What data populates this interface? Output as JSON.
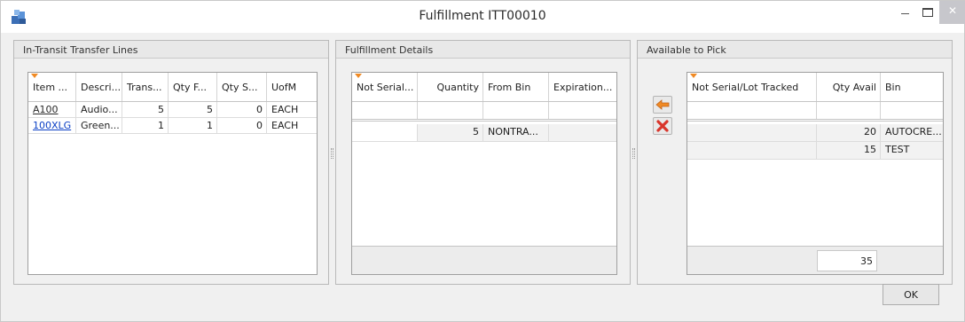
{
  "window": {
    "title": "Fulfillment ITT00010",
    "close_glyph": "✕"
  },
  "lines": {
    "header": "In-Transit Transfer Lines",
    "columns": [
      "Item ...",
      "Descri...",
      "Trans...",
      "Qty F...",
      "Qty S...",
      "UofM"
    ],
    "rows": [
      [
        "A100",
        "Audio...",
        "5",
        "5",
        "0",
        "EACH"
      ],
      [
        "100XLG",
        "Green...",
        "1",
        "1",
        "0",
        "EACH"
      ]
    ]
  },
  "details": {
    "header": "Fulfillment Details",
    "columns": [
      "Not Serial...",
      "Quantity",
      "From Bin",
      "Expiration..."
    ],
    "rows": [
      [
        "",
        "5",
        "NONTRA...",
        ""
      ]
    ]
  },
  "pick": {
    "header": "Available to Pick",
    "columns": [
      "Not Serial/Lot Tracked",
      "Qty Avail",
      "Bin"
    ],
    "rows": [
      [
        "",
        "20",
        "AUTOCRE..."
      ],
      [
        "",
        "15",
        "TEST"
      ]
    ],
    "total": "35"
  },
  "actions": {
    "ok_label": "OK"
  },
  "colors": {
    "accent_orange": "#f08a24",
    "remove_red": "#d9352b",
    "link_blue": "#0b3fc5"
  }
}
